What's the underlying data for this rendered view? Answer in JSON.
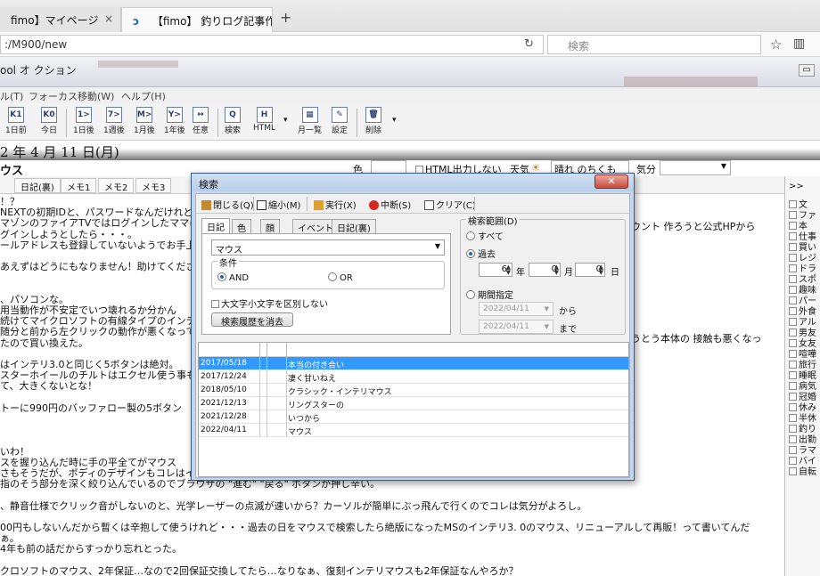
{
  "browser": {
    "tabs": [
      {
        "label": "fimo】マイページ",
        "active": false
      },
      {
        "label": "【fimo】 釣りログ記事作成",
        "active": true
      }
    ],
    "close_glyph": "×",
    "new_tab_glyph": "+",
    "url": ":/M900/new",
    "search_placeholder": "検索"
  },
  "app": {
    "title_fragment": "ool オ  クション",
    "menus": [
      "ル(T)",
      "フォーカス移動(W)",
      "ヘルプ(H)"
    ],
    "toolbar": [
      {
        "icon": "K1",
        "label": "1日前"
      },
      {
        "icon": "K0",
        "label": "今日"
      },
      {
        "icon": "1>",
        "label": "1日後"
      },
      {
        "icon": "7>",
        "label": "1週後"
      },
      {
        "icon": "M>",
        "label": "1月後"
      },
      {
        "icon": "Y>",
        "label": "1年後"
      },
      {
        "icon": "↔",
        "label": "任意"
      },
      {
        "icon": "Q",
        "label": "検索"
      },
      {
        "icon": "H",
        "label": "HTML"
      },
      {
        "icon": "▦",
        "label": "月一覧"
      },
      {
        "icon": "✎",
        "label": "設定"
      },
      {
        "icon": "🗑",
        "label": "削除"
      }
    ],
    "date_heading": "2 年 4 月 11 日(月)",
    "entry_title": "ウス",
    "color_label": "色",
    "html_output_label": "HTML出力しない",
    "weather_label": "天気",
    "weather_value": "晴れ のちくもり",
    "mood_label": "気分",
    "subtabs": [
      "日記(裏)",
      "メモ1",
      "メモ2",
      "メモ3"
    ],
    "body_lines": [
      "！？",
      "NEXTの初期IDと、パスワードなんだけれど",
      "マゾンのファイアTVではログインしたママにな",
      "グインしようとしたら・・・。",
      "ールアドレスも登録していないようでお手上げ",
      "",
      "あえずはどうにもなりません！助けてくださ",
      "",
      "",
      "、パソコンな。",
      "用当動作が不安定でいつ壊れるか分かん",
      "続けてマイクロソフトの有線タイプのインテ",
      "随分と前から左クリックの動作が悪くなって",
      "たので買い換えた。",
      "",
      "はインテリ3.0と同じく5ボタンは絶対。",
      "スターホイールのチルトはエクセル使う事も結",
      "て、大きくないとな！",
      "",
      "トーに990円のバッファロー製の5ボタン",
      "",
      "",
      "",
      "いわ！",
      "スを握り込んだ時に手の平全てがマウス",
      "さもそうだが、ボディのデザインもコレはイマ",
      "指のそう部分を深く絞り込んでいるのでブラウザの \"進む\" \"戻る\" ボタンが押し辛い。",
      "",
      "、静音仕様でクリック音がしないのと、光学レーザーの点滅が速いから？カーソルが簡単にぶっ飛んで行くのでコレは気分がよろし。",
      "",
      "00円もしないんだから暫くは辛抱して使うけれど・・・過去の日をマウスで検索したら絶版になったMSのインテリ3. 0のマウス、リニューアルして再販！って書いてんだ",
      "ぁ。",
      "4年も前の話だからすっかり忘れとった。",
      "",
      "クロソフトのマウス、2年保証…なので2回保証交換してたら…なりなぁ、復刻インテリマウスも2年保証なんやろか？"
    ],
    "right_fragments": [
      "ウント 作ろうと公式HPから",
      "うとう本体の 接触も悪くなっ"
    ],
    "sidepane": {
      "header": ">>",
      "items": [
        "文",
        "ファ",
        "本",
        "仕事",
        "買い",
        "レジ",
        "ドラ",
        "スポ",
        "趣味",
        "パー",
        "外食",
        "アル",
        "男友",
        "女友",
        "喧嘩",
        "旅行",
        "睡眠",
        "病気",
        "冠婚",
        "休み",
        "半休",
        "釣り",
        "出勤",
        "ラマ",
        "バイ",
        "自転"
      ]
    }
  },
  "dialog": {
    "title": "検索",
    "close_glyph": "✕",
    "tools": [
      {
        "label": "閉じる(Q)",
        "icon": "book-icon"
      },
      {
        "label": "縮小(M)",
        "icon": "shrink-icon"
      },
      {
        "label": "実行(X)",
        "icon": "run-icon"
      },
      {
        "label": "中断(S)",
        "icon": "stop-icon"
      },
      {
        "label": "クリア(C)",
        "icon": "clear-icon"
      }
    ],
    "cond_tabs": [
      "日記",
      "色",
      "顔",
      "イベント",
      "日記(裏)"
    ],
    "keyword": "マウス",
    "condition_legend": "条件",
    "and_label": "AND",
    "or_label": "OR",
    "case_label": "大文字小文字を区別しない",
    "clear_history": "検索履歴を消去",
    "range_legend": "検索範囲(D)",
    "all_label": "すべて",
    "past_label": "過去",
    "past_years": "6",
    "past_months": "0",
    "past_days": "0",
    "unit_year": "年",
    "unit_month": "月",
    "unit_day": "日",
    "period_label": "期間指定",
    "from_date": "2022/04/11",
    "from_label": "から",
    "to_date": "2022/04/11",
    "to_label": "まで",
    "results": [
      {
        "date": "2017/05/18",
        "title": "本当の付き合い",
        "selected": true
      },
      {
        "date": "2017/12/24",
        "title": "凄く甘いねえ",
        "selected": false
      },
      {
        "date": "2018/05/10",
        "title": "クラシック・インテリマウス",
        "selected": false
      },
      {
        "date": "2021/12/13",
        "title": "リングスターの",
        "selected": false
      },
      {
        "date": "2021/12/28",
        "title": "いつから",
        "selected": false
      },
      {
        "date": "2022/04/11",
        "title": "マウス",
        "selected": false
      }
    ]
  },
  "colors": {
    "selection": "#3399ff",
    "dialog_frame": "#c5d6ec",
    "close_button": "#c64a3c"
  }
}
